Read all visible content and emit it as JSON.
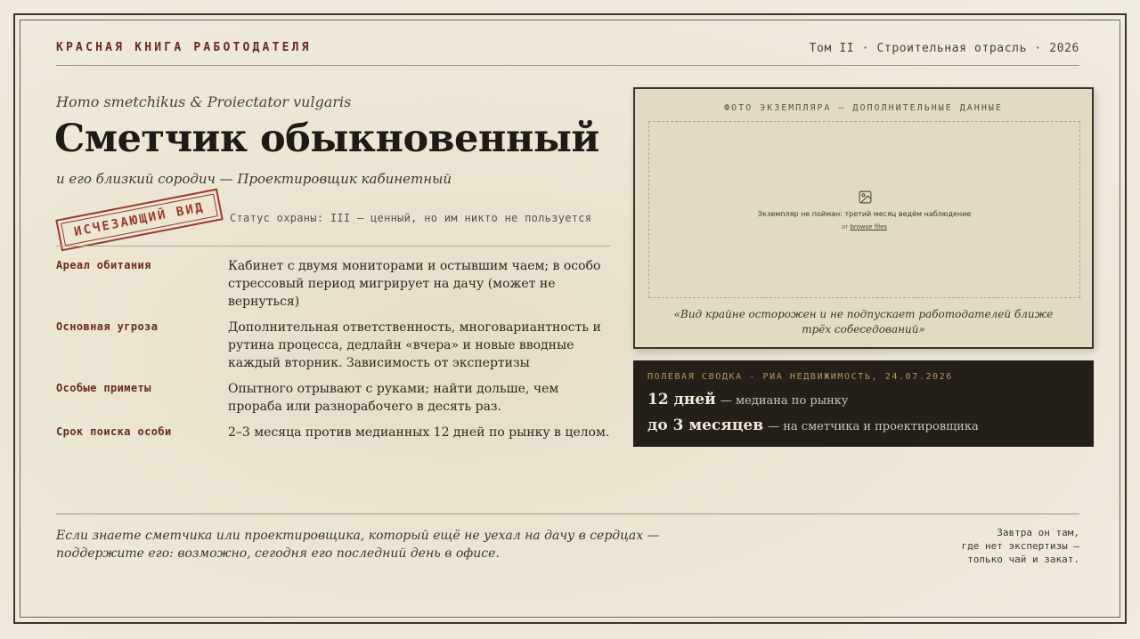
{
  "header": {
    "left": "КРАСНАЯ КНИГА РАБОТОДАТЕЛЯ",
    "right": "Том II · Строительная отрасль · 2026"
  },
  "species": {
    "latin": "Homo smetchikus & Proiectator vulgaris",
    "title": "Сметчик обыкновенный",
    "subtitle": "и его близкий сородич — Проектировщик кабинетный"
  },
  "stamp": "ИСЧЕЗАЮЩИЙ ВИД",
  "status": "Статус охраны: III — ценный, но им никто не пользуется",
  "facts": [
    {
      "label": "Ареал обитания",
      "text": "Кабинет с двумя мониторами и остывшим чаем; в особо стрессовый период мигрирует на дачу (может не вернуться)"
    },
    {
      "label": "Основная угроза",
      "text": "Дополнительная ответственность, многовариантность и рутина процесса, дедлайн «вчера» и новые вводные каждый вторник. Зависимость от экспертизы"
    },
    {
      "label": "Особые приметы",
      "text": "Опытного отрывают с руками; найти дольше, чем прораба или разнорабочего в десять раз."
    },
    {
      "label": "Срок поиска особи",
      "text": "2–3 месяца против медианных 12 дней по рынку в целом."
    }
  ],
  "photo": {
    "heading": "ФОТО ЭКЗЕМПЛЯРА — ДОПОЛНИТЕЛЬНЫЕ ДАННЫЕ",
    "dropzone_text": "Экземпляр не пойман: третий месяц ведём наблюдение",
    "or_text": "or",
    "browse_text": "browse files",
    "icon": "image-icon",
    "quote": "«Вид крайне осторожен и не подпускает работодателей ближе трёх собеседований»"
  },
  "field_report": {
    "heading": "ПОЛЕВАЯ СВОДКА · РИА НЕДВИЖИМОСТЬ, 24.07.2026",
    "rows": [
      {
        "value": "12 дней",
        "desc": "— медиана по рынку"
      },
      {
        "value": "до 3 месяцев",
        "desc": "— на сметчика и проектировщика"
      }
    ]
  },
  "footer": {
    "left": "Если знаете сметчика или проектировщика, который ещё не уехал на дачу в сердцах — поддержите его: возможно, сегодня его последний день в офисе.",
    "right_lines": [
      "Завтра он там,",
      "где нет экспертизы —",
      "только чай и закат."
    ]
  },
  "colors": {
    "accent_red": "#6b2a1e",
    "stamp_red": "#9a3a2c",
    "paper": "#ece6d4",
    "dark_panel": "#241f19",
    "gold": "#b8975c"
  }
}
